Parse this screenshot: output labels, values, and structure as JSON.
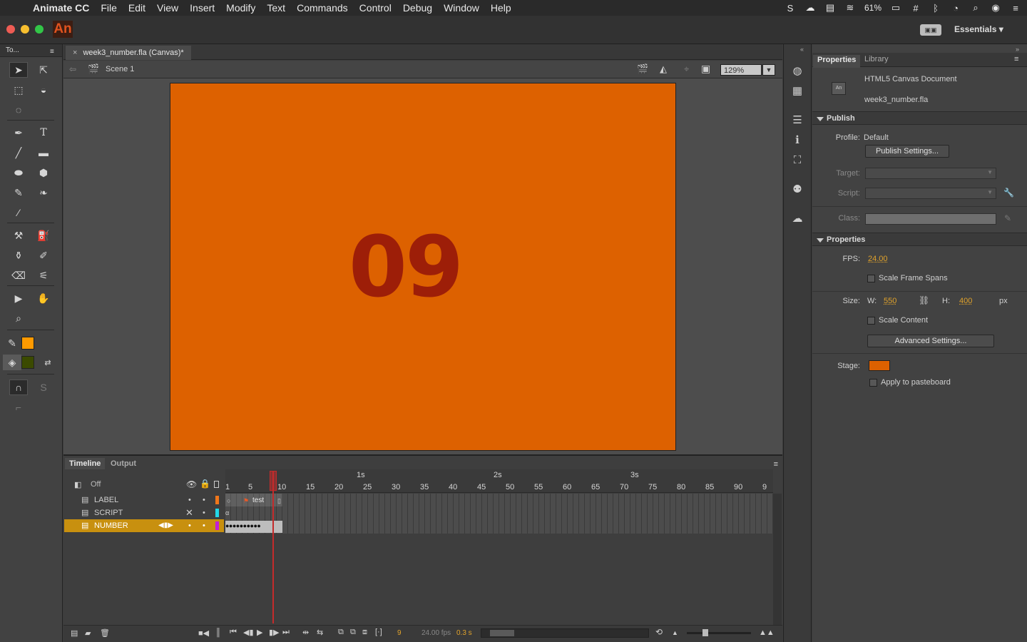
{
  "menubar": {
    "app": "Animate CC",
    "items": [
      "File",
      "Edit",
      "View",
      "Insert",
      "Modify",
      "Text",
      "Commands",
      "Control",
      "Debug",
      "Window",
      "Help"
    ],
    "battery": "61%"
  },
  "titlebar": {
    "logo": "An",
    "workspace": "Essentials"
  },
  "tools": {
    "title": "To..."
  },
  "document": {
    "tab_title": "week3_number.fla (Canvas)*",
    "scene": "Scene 1",
    "zoom": "129%",
    "stage_text": "09",
    "stage_color": "#dd6100",
    "text_color": "#9d1e08"
  },
  "timeline": {
    "tabs": [
      "Timeline",
      "Output"
    ],
    "onion": "Off",
    "seconds": [
      "1s",
      "2s",
      "3s"
    ],
    "ruler": [
      "1",
      "5",
      "10",
      "15",
      "20",
      "25",
      "30",
      "35",
      "40",
      "45",
      "50",
      "55",
      "60",
      "65",
      "70",
      "75",
      "80",
      "85",
      "90",
      "9"
    ],
    "layers": [
      {
        "name": "LABEL",
        "color": "#f0761a",
        "selected": false
      },
      {
        "name": "SCRIPT",
        "color": "#22d7e8",
        "selected": false
      },
      {
        "name": "NUMBER",
        "color": "#c21fd8",
        "selected": true
      }
    ],
    "frame_label": "test",
    "current_frame": "9",
    "fps": "24.00 fps",
    "elapsed": "0.3 s"
  },
  "properties": {
    "tabs": [
      "Properties",
      "Library"
    ],
    "doc_type": "HTML5 Canvas Document",
    "file_name": "week3_number.fla",
    "publish_header": "Publish",
    "profile_label": "Profile:",
    "profile_value": "Default",
    "publish_settings_btn": "Publish Settings...",
    "target_label": "Target:",
    "script_label": "Script:",
    "class_label": "Class:",
    "properties_header": "Properties",
    "fps_label": "FPS:",
    "fps_value": "24.00",
    "scale_frame_spans": "Scale Frame Spans",
    "size_label": "Size:",
    "w_label": "W:",
    "w_value": "550",
    "h_label": "H:",
    "h_value": "400",
    "px": "px",
    "scale_content": "Scale Content",
    "advanced_btn": "Advanced Settings...",
    "stage_label": "Stage:",
    "stage_swatch": "#dd6100",
    "apply_pasteboard": "Apply to pasteboard"
  }
}
